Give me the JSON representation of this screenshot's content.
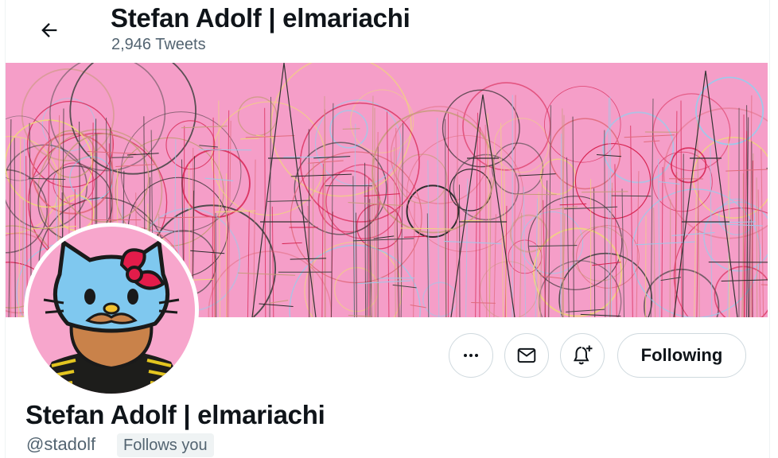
{
  "header": {
    "title": "Stefan Adolf | elmariachi",
    "tweet_count": "2,946 Tweets",
    "back_icon": "arrow-left-icon"
  },
  "colors": {
    "banner_bg": "#f59ec8",
    "avatar_bg": "#f7a6cc",
    "text_primary": "#0f1419",
    "text_secondary": "#536471",
    "border": "#cfd9de"
  },
  "actions": {
    "more_icon": "more-icon",
    "message_icon": "envelope-icon",
    "notify_icon": "bell-plus-icon",
    "following_label": "Following"
  },
  "profile": {
    "name": "Stefan Adolf | elmariachi",
    "handle": "@stadolf",
    "follows_you": "Follows you"
  }
}
